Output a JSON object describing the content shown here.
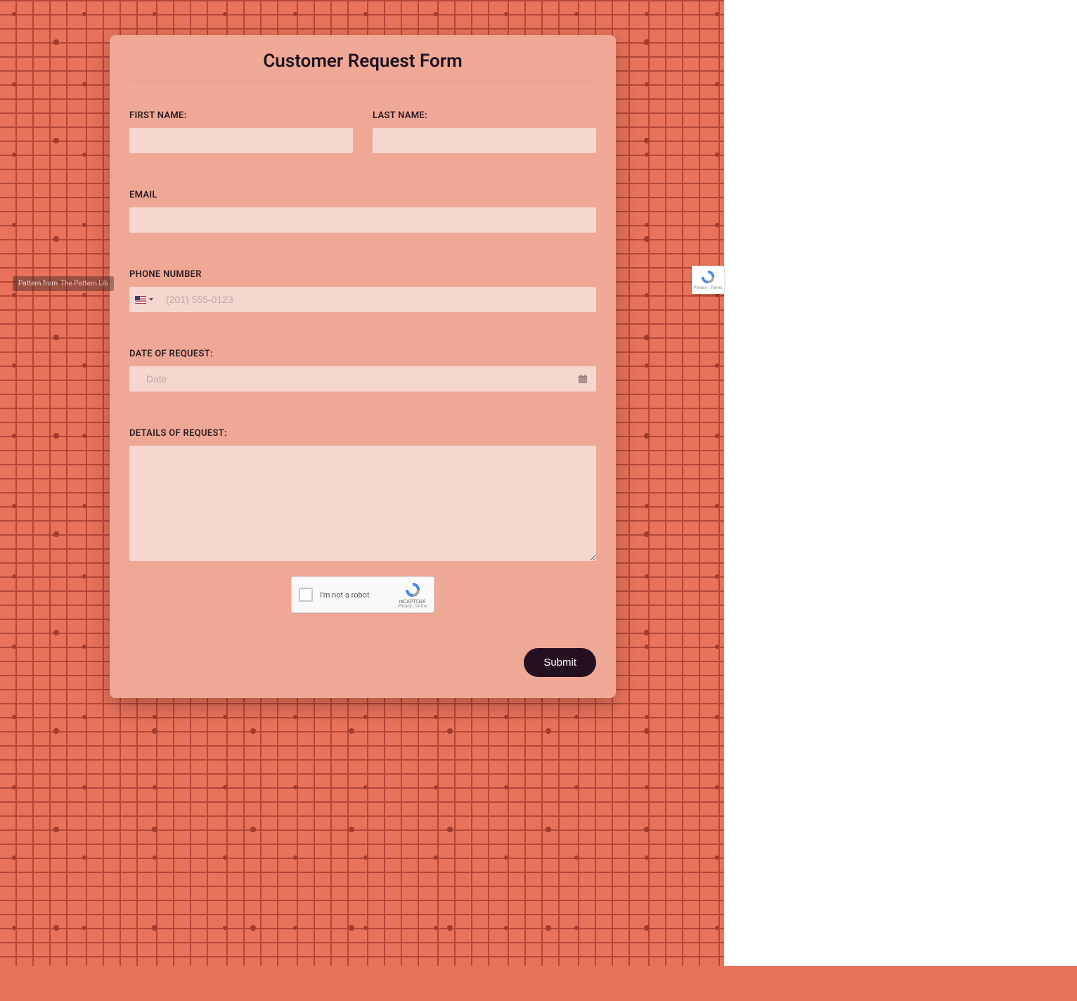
{
  "form": {
    "title": "Customer Request Form",
    "first_name": {
      "label": "FIRST NAME:",
      "value": ""
    },
    "last_name": {
      "label": "LAST NAME:",
      "value": ""
    },
    "email": {
      "label": "EMAIL",
      "value": ""
    },
    "phone": {
      "label": "PHONE NUMBER",
      "placeholder": "(201) 555-0123",
      "value": "",
      "country": "US"
    },
    "date": {
      "label": "DATE OF REQUEST:",
      "placeholder": "Date",
      "value": ""
    },
    "details": {
      "label": "DETAILS OF REQUEST:",
      "value": ""
    },
    "recaptcha": {
      "label": "I'm not a robot",
      "brand": "reCAPTCHA",
      "legal": "Privacy - Terms"
    },
    "submit_label": "Submit"
  },
  "attribution": {
    "prefix": "Pattern from ",
    "link_text": "The Pattern Lib"
  },
  "floating_recaptcha": {
    "legal": "Privacy - Terms"
  }
}
